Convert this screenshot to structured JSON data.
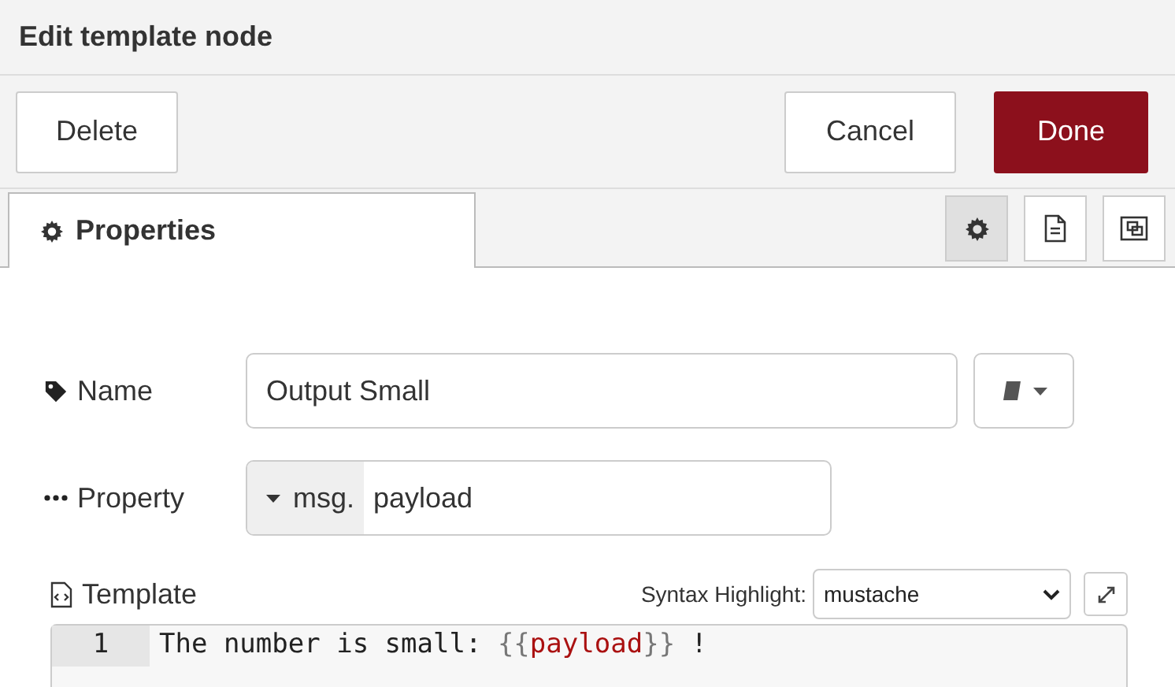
{
  "window": {
    "title": "Edit template node"
  },
  "actions": {
    "left": [
      {
        "label": "Delete"
      }
    ],
    "right": [
      {
        "label": "Cancel",
        "kind": "plain"
      },
      {
        "label": "Done",
        "kind": "primary"
      }
    ]
  },
  "tabs": [
    {
      "label": "Properties",
      "selected": true
    }
  ],
  "side_tabs": [
    {
      "kind": "gear",
      "selected": true
    },
    {
      "kind": "document",
      "selected": false
    },
    {
      "kind": "frame",
      "selected": false
    }
  ],
  "fields": [
    {
      "label": "Name",
      "kind": "name",
      "value": "Output Small"
    },
    {
      "label": "Property",
      "kind": "property",
      "prefix": "msg.",
      "value": "payload"
    }
  ],
  "template": {
    "label": "Template",
    "syntax_label": "Syntax Highlight:",
    "syntax": "mustache",
    "lines": [
      {
        "number": "1",
        "tokens": [
          {
            "kind": "text",
            "text": "The number is small: "
          },
          {
            "kind": "brace",
            "text": "{{"
          },
          {
            "kind": "variable",
            "text": "payload"
          },
          {
            "kind": "brace",
            "text": "}}"
          },
          {
            "kind": "text",
            "text": " !"
          }
        ]
      }
    ]
  }
}
